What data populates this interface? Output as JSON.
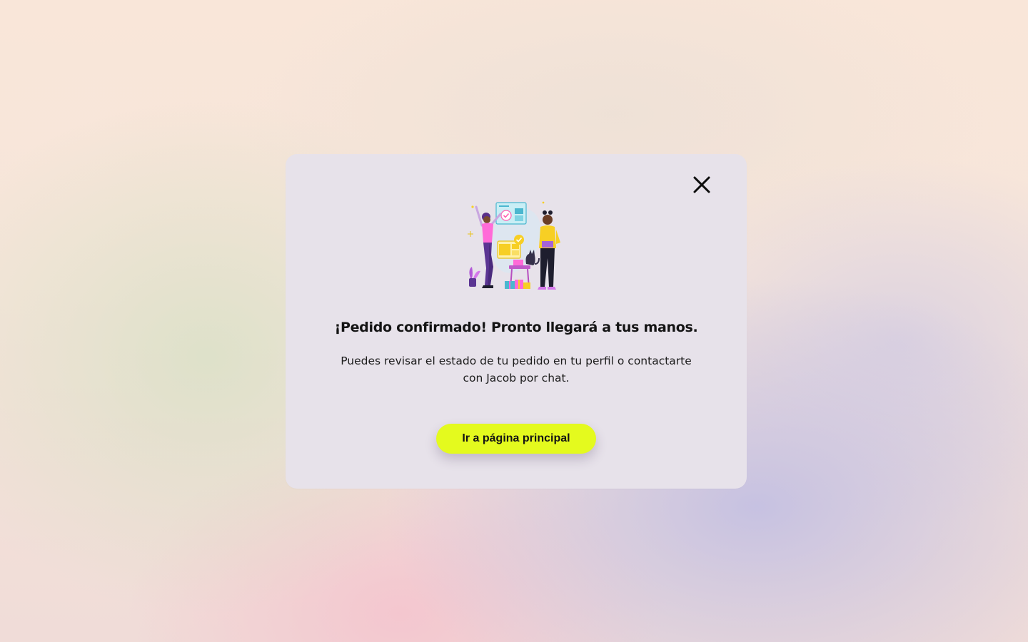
{
  "modal": {
    "title": "¡Pedido confirmado! Pronto llegará a tus manos.",
    "description": "Puedes revisar el estado de tu pedido en tu perfil o contactarte con Jacob por chat.",
    "button_label": "Ir a página principal",
    "close_icon": "close-icon",
    "illustration": "order-confirmed-illustration"
  },
  "colors": {
    "button_bg": "#e4fa1e",
    "modal_bg": "#e7e2ea",
    "text": "#141414"
  }
}
